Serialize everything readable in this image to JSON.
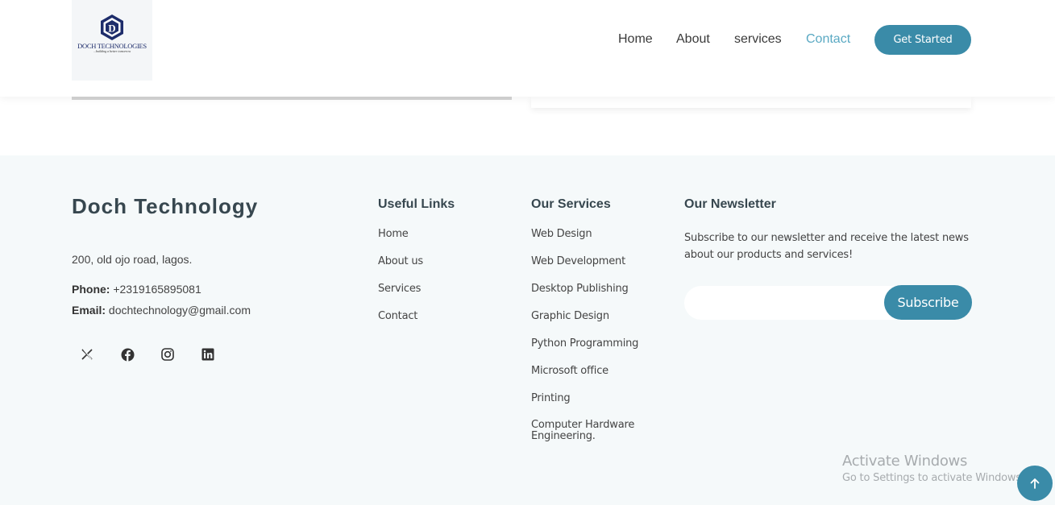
{
  "header": {
    "logo": {
      "letter": "D",
      "brand": "DOCH TECHNOLOGIES",
      "tagline": "...building a better tomorrow"
    },
    "nav": {
      "items": [
        {
          "label": "Home",
          "active": false
        },
        {
          "label": "About",
          "active": false
        },
        {
          "label": "services",
          "active": false
        },
        {
          "label": "Contact",
          "active": true
        }
      ],
      "cta_label": "Get Started"
    }
  },
  "footer": {
    "brand": {
      "title": "Doch Technology",
      "address": "200, old ojo road, lagos.",
      "phone_label": "Phone:",
      "phone": "+2319165895081",
      "email_label": "Email:",
      "email": "dochtechnology@gmail.com",
      "social_icons": [
        "x-icon",
        "facebook-icon",
        "instagram-icon",
        "linkedin-icon"
      ]
    },
    "useful_links": {
      "title": "Useful Links",
      "items": [
        "Home",
        "About us",
        "Services",
        "Contact"
      ]
    },
    "services": {
      "title": "Our Services",
      "items": [
        "Web Design",
        "Web Development",
        "Desktop Publishing",
        "Graphic Design",
        "Python Programming",
        "Microsoft office",
        "Printing",
        "Computer Hardware Engineering."
      ]
    },
    "newsletter": {
      "title": "Our Newsletter",
      "text": "Subscribe to our newsletter and receive the latest news about our products and services!",
      "input_value": "",
      "button_label": "Subscribe"
    }
  },
  "watermark": {
    "line1": "Activate Windows",
    "line2": "Go to Settings to activate Windows."
  },
  "back_to_top_icon": "arrow-up-icon",
  "colors": {
    "accent": "#3a8ba8",
    "nav_active": "#5aa9c3",
    "heading": "#37474f",
    "footer_bg": "#f5f9fa",
    "logo_navy": "#1e2d6b"
  }
}
